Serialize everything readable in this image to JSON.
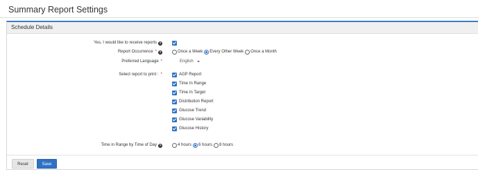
{
  "page": {
    "title": "Summary Report Settings"
  },
  "panel": {
    "title": "Schedule Details"
  },
  "form": {
    "receive_reports": {
      "label": "Yes, I would like to receive reports",
      "checked": true
    },
    "report_occurrence": {
      "label": "Report Occurrence",
      "required": "*",
      "options": [
        {
          "label": "Once a Week",
          "selected": false
        },
        {
          "label": "Every Other Week",
          "selected": true
        },
        {
          "label": "Once a Month",
          "selected": false
        }
      ]
    },
    "preferred_language": {
      "label": "Preferred Language",
      "required": "*",
      "value": "English"
    },
    "reports": {
      "label": "Select report to print :",
      "required": "*",
      "items": [
        {
          "label": "AGP Report",
          "checked": true
        },
        {
          "label": "Time In Range",
          "checked": true
        },
        {
          "label": "Time In Target",
          "checked": true
        },
        {
          "label": "Distribution Report",
          "checked": true
        },
        {
          "label": "Glucose Trend",
          "checked": true
        },
        {
          "label": "Glucose Variability",
          "checked": true
        },
        {
          "label": "Glucose History",
          "checked": true
        }
      ]
    },
    "time_in_range": {
      "label": "Time in Range by Time of Day",
      "options": [
        {
          "label": "4 hours",
          "selected": false
        },
        {
          "label": "6 hours",
          "selected": true
        },
        {
          "label": "8 hours",
          "selected": false
        }
      ]
    }
  },
  "buttons": {
    "reset": "Reset",
    "save": "Save"
  },
  "colors": {
    "accent": "#2f72c4",
    "required": "#c62828",
    "panel_header_bg": "#f0f0f0"
  }
}
